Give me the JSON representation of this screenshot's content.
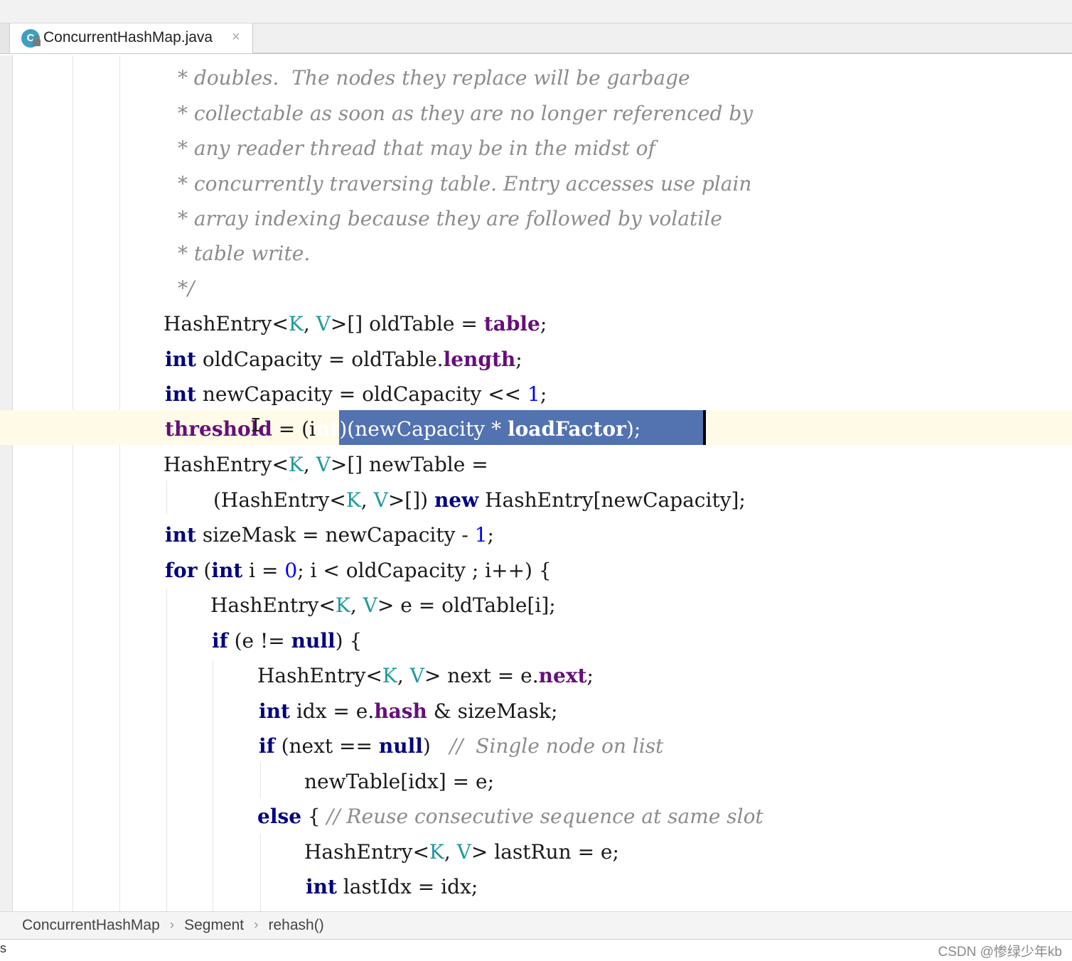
{
  "tab": {
    "icon_letter": "C",
    "filename": "ConcurrentHashMap.java",
    "close_glyph": "×"
  },
  "code": {
    "comment_lines": [
      "* doubles.  The nodes they replace will be garbage",
      "* collectable as soon as they are no longer referenced by",
      "* any reader thread that may be in the midst of",
      "* concurrently traversing table. Entry accesses use plain",
      "* array indexing because they are followed by volatile",
      "* table write.",
      "*/"
    ],
    "line8": {
      "a": "HashEntry",
      "b": "<",
      "c": "K",
      "d": ", ",
      "e": "V",
      "f": ">[] oldTable = ",
      "g": "table",
      "h": ";"
    },
    "line9": {
      "a": "int",
      "b": " oldCapacity = oldTable.",
      "c": "length",
      "d": ";"
    },
    "line10": {
      "a": "int",
      "b": " newCapacity = oldCapacity << ",
      "c": "1",
      "d": ";"
    },
    "line11": {
      "a": "threshold",
      "b": " = (i",
      "c": "nt",
      "d": ")(newCapacity * ",
      "e": "loadFactor",
      "f": ");"
    },
    "line12": {
      "a": "HashEntry",
      "b": "<",
      "c": "K",
      "d": ", ",
      "e": "V",
      "f": ">[] newTable ="
    },
    "line13": {
      "a": "(HashEntry",
      "b": "<",
      "c": "K",
      "d": ", ",
      "e": "V",
      "f": ">[]) ",
      "g": "new",
      "h": " HashEntry[newCapacity];"
    },
    "line14": {
      "a": "int",
      "b": " sizeMask = newCapacity - ",
      "c": "1",
      "d": ";"
    },
    "line15": {
      "a": "for",
      "b": " (",
      "c": "int",
      "d": " i = ",
      "e": "0",
      "f": "; i < oldCapacity ; i++) {"
    },
    "line16": {
      "a": "HashEntry",
      "b": "<",
      "c": "K",
      "d": ", ",
      "e": "V",
      "f": "> e = oldTable[i];"
    },
    "line17": {
      "a": "if",
      "b": " (e != ",
      "c": "null",
      "d": ") {"
    },
    "line18": {
      "a": "HashEntry",
      "b": "<",
      "c": "K",
      "d": ", ",
      "e": "V",
      "f": "> next = e.",
      "g": "next",
      "h": ";"
    },
    "line19": {
      "a": "int",
      "b": " idx = e.",
      "c": "hash",
      "d": " & sizeMask;"
    },
    "line20": {
      "a": "if",
      "b": " (next == ",
      "c": "null",
      "d": ")   ",
      "e": "//  Single node on list"
    },
    "line21": {
      "a": "newTable[idx] = e;"
    },
    "line22": {
      "a": "else",
      "b": " { ",
      "c": "// Reuse consecutive sequence at same slot"
    },
    "line23": {
      "a": "HashEntry",
      "b": "<",
      "c": "K",
      "d": ", ",
      "e": "V",
      "f": "> lastRun = e;"
    },
    "line24": {
      "a": "int",
      "b": " lastIdx = idx;"
    }
  },
  "breadcrumb": {
    "items": [
      "ConcurrentHashMap",
      "Segment",
      "rehash()"
    ],
    "separator": "›"
  },
  "status": {
    "left_text": "s",
    "watermark": "CSDN @惨绿少年kb"
  }
}
